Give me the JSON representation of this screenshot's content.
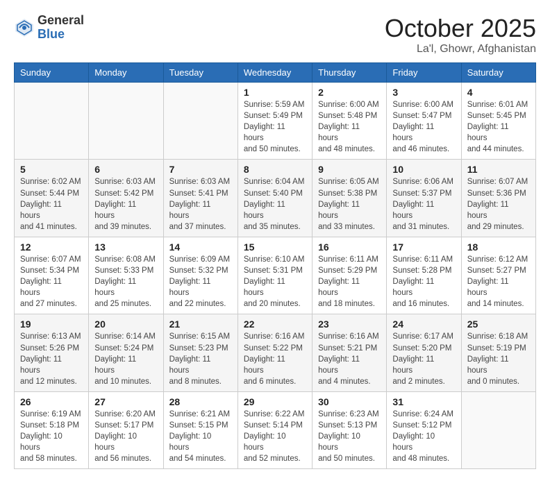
{
  "header": {
    "logo": {
      "general": "General",
      "blue": "Blue"
    },
    "title": "October 2025",
    "location": "La'l, Ghowr, Afghanistan"
  },
  "weekdays": [
    "Sunday",
    "Monday",
    "Tuesday",
    "Wednesday",
    "Thursday",
    "Friday",
    "Saturday"
  ],
  "weeks": [
    [
      {
        "day": "",
        "info": ""
      },
      {
        "day": "",
        "info": ""
      },
      {
        "day": "",
        "info": ""
      },
      {
        "day": "1",
        "info": "Sunrise: 5:59 AM\nSunset: 5:49 PM\nDaylight: 11 hours\nand 50 minutes."
      },
      {
        "day": "2",
        "info": "Sunrise: 6:00 AM\nSunset: 5:48 PM\nDaylight: 11 hours\nand 48 minutes."
      },
      {
        "day": "3",
        "info": "Sunrise: 6:00 AM\nSunset: 5:47 PM\nDaylight: 11 hours\nand 46 minutes."
      },
      {
        "day": "4",
        "info": "Sunrise: 6:01 AM\nSunset: 5:45 PM\nDaylight: 11 hours\nand 44 minutes."
      }
    ],
    [
      {
        "day": "5",
        "info": "Sunrise: 6:02 AM\nSunset: 5:44 PM\nDaylight: 11 hours\nand 41 minutes."
      },
      {
        "day": "6",
        "info": "Sunrise: 6:03 AM\nSunset: 5:42 PM\nDaylight: 11 hours\nand 39 minutes."
      },
      {
        "day": "7",
        "info": "Sunrise: 6:03 AM\nSunset: 5:41 PM\nDaylight: 11 hours\nand 37 minutes."
      },
      {
        "day": "8",
        "info": "Sunrise: 6:04 AM\nSunset: 5:40 PM\nDaylight: 11 hours\nand 35 minutes."
      },
      {
        "day": "9",
        "info": "Sunrise: 6:05 AM\nSunset: 5:38 PM\nDaylight: 11 hours\nand 33 minutes."
      },
      {
        "day": "10",
        "info": "Sunrise: 6:06 AM\nSunset: 5:37 PM\nDaylight: 11 hours\nand 31 minutes."
      },
      {
        "day": "11",
        "info": "Sunrise: 6:07 AM\nSunset: 5:36 PM\nDaylight: 11 hours\nand 29 minutes."
      }
    ],
    [
      {
        "day": "12",
        "info": "Sunrise: 6:07 AM\nSunset: 5:34 PM\nDaylight: 11 hours\nand 27 minutes."
      },
      {
        "day": "13",
        "info": "Sunrise: 6:08 AM\nSunset: 5:33 PM\nDaylight: 11 hours\nand 25 minutes."
      },
      {
        "day": "14",
        "info": "Sunrise: 6:09 AM\nSunset: 5:32 PM\nDaylight: 11 hours\nand 22 minutes."
      },
      {
        "day": "15",
        "info": "Sunrise: 6:10 AM\nSunset: 5:31 PM\nDaylight: 11 hours\nand 20 minutes."
      },
      {
        "day": "16",
        "info": "Sunrise: 6:11 AM\nSunset: 5:29 PM\nDaylight: 11 hours\nand 18 minutes."
      },
      {
        "day": "17",
        "info": "Sunrise: 6:11 AM\nSunset: 5:28 PM\nDaylight: 11 hours\nand 16 minutes."
      },
      {
        "day": "18",
        "info": "Sunrise: 6:12 AM\nSunset: 5:27 PM\nDaylight: 11 hours\nand 14 minutes."
      }
    ],
    [
      {
        "day": "19",
        "info": "Sunrise: 6:13 AM\nSunset: 5:26 PM\nDaylight: 11 hours\nand 12 minutes."
      },
      {
        "day": "20",
        "info": "Sunrise: 6:14 AM\nSunset: 5:24 PM\nDaylight: 11 hours\nand 10 minutes."
      },
      {
        "day": "21",
        "info": "Sunrise: 6:15 AM\nSunset: 5:23 PM\nDaylight: 11 hours\nand 8 minutes."
      },
      {
        "day": "22",
        "info": "Sunrise: 6:16 AM\nSunset: 5:22 PM\nDaylight: 11 hours\nand 6 minutes."
      },
      {
        "day": "23",
        "info": "Sunrise: 6:16 AM\nSunset: 5:21 PM\nDaylight: 11 hours\nand 4 minutes."
      },
      {
        "day": "24",
        "info": "Sunrise: 6:17 AM\nSunset: 5:20 PM\nDaylight: 11 hours\nand 2 minutes."
      },
      {
        "day": "25",
        "info": "Sunrise: 6:18 AM\nSunset: 5:19 PM\nDaylight: 11 hours\nand 0 minutes."
      }
    ],
    [
      {
        "day": "26",
        "info": "Sunrise: 6:19 AM\nSunset: 5:18 PM\nDaylight: 10 hours\nand 58 minutes."
      },
      {
        "day": "27",
        "info": "Sunrise: 6:20 AM\nSunset: 5:17 PM\nDaylight: 10 hours\nand 56 minutes."
      },
      {
        "day": "28",
        "info": "Sunrise: 6:21 AM\nSunset: 5:15 PM\nDaylight: 10 hours\nand 54 minutes."
      },
      {
        "day": "29",
        "info": "Sunrise: 6:22 AM\nSunset: 5:14 PM\nDaylight: 10 hours\nand 52 minutes."
      },
      {
        "day": "30",
        "info": "Sunrise: 6:23 AM\nSunset: 5:13 PM\nDaylight: 10 hours\nand 50 minutes."
      },
      {
        "day": "31",
        "info": "Sunrise: 6:24 AM\nSunset: 5:12 PM\nDaylight: 10 hours\nand 48 minutes."
      },
      {
        "day": "",
        "info": ""
      }
    ]
  ]
}
